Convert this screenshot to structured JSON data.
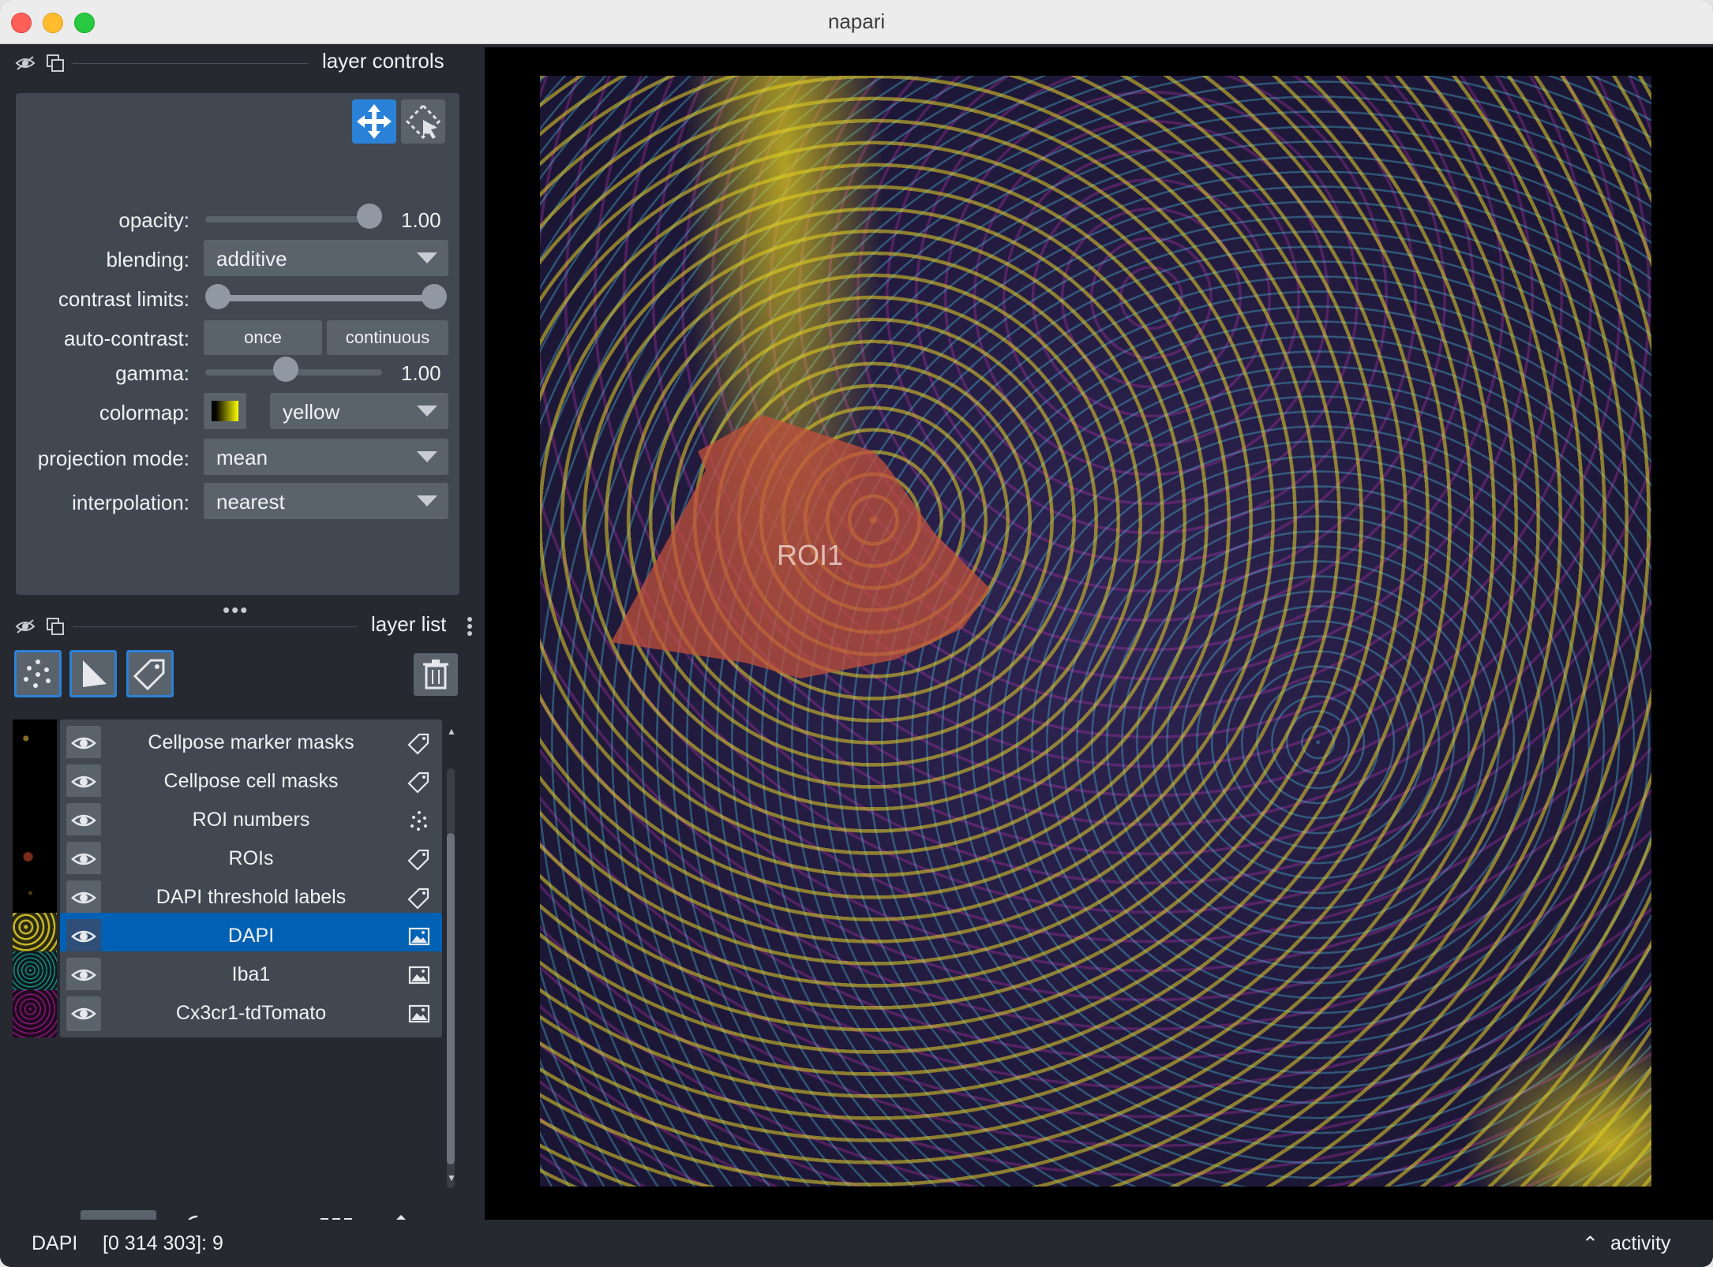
{
  "window": {
    "title": "napari"
  },
  "layer_controls": {
    "title": "layer controls",
    "opacity_label": "opacity:",
    "opacity_value": "1.00",
    "opacity_fraction": 1.0,
    "blending_label": "blending:",
    "blending_value": "additive",
    "contrast_label": "contrast limits:",
    "contrast_range": [
      0.0,
      1.0
    ],
    "autocontrast_label": "auto-contrast:",
    "autocontrast_once": "once",
    "autocontrast_continuous": "continuous",
    "gamma_label": "gamma:",
    "gamma_value": "1.00",
    "gamma_fraction": 0.45,
    "colormap_label": "colormap:",
    "colormap_value": "yellow",
    "projection_label": "projection mode:",
    "projection_value": "mean",
    "interpolation_label": "interpolation:",
    "interpolation_value": "nearest"
  },
  "layer_list": {
    "title": "layer list",
    "layers": [
      {
        "name": "Cellpose marker masks",
        "type_icon": "labels-icon",
        "selected": false
      },
      {
        "name": "Cellpose cell masks",
        "type_icon": "labels-icon",
        "selected": false
      },
      {
        "name": "ROI numbers",
        "type_icon": "points-icon",
        "selected": false
      },
      {
        "name": "ROIs",
        "type_icon": "labels-icon",
        "selected": false
      },
      {
        "name": "DAPI threshold labels",
        "type_icon": "labels-icon",
        "selected": false
      },
      {
        "name": "DAPI",
        "type_icon": "image-icon",
        "selected": true
      },
      {
        "name": "Iba1",
        "type_icon": "image-icon",
        "selected": false
      },
      {
        "name": "Cx3cr1-tdTomato",
        "type_icon": "image-icon",
        "selected": false
      }
    ]
  },
  "canvas": {
    "roi_label": "ROI1"
  },
  "colors": {
    "accent": "#2a82d8",
    "selected": "#0061b4",
    "roi_fill": "#c0503c",
    "panel": "#414851"
  },
  "status": {
    "layer": "DAPI",
    "coords": "[0 314 303]: 9",
    "activity": "activity"
  }
}
